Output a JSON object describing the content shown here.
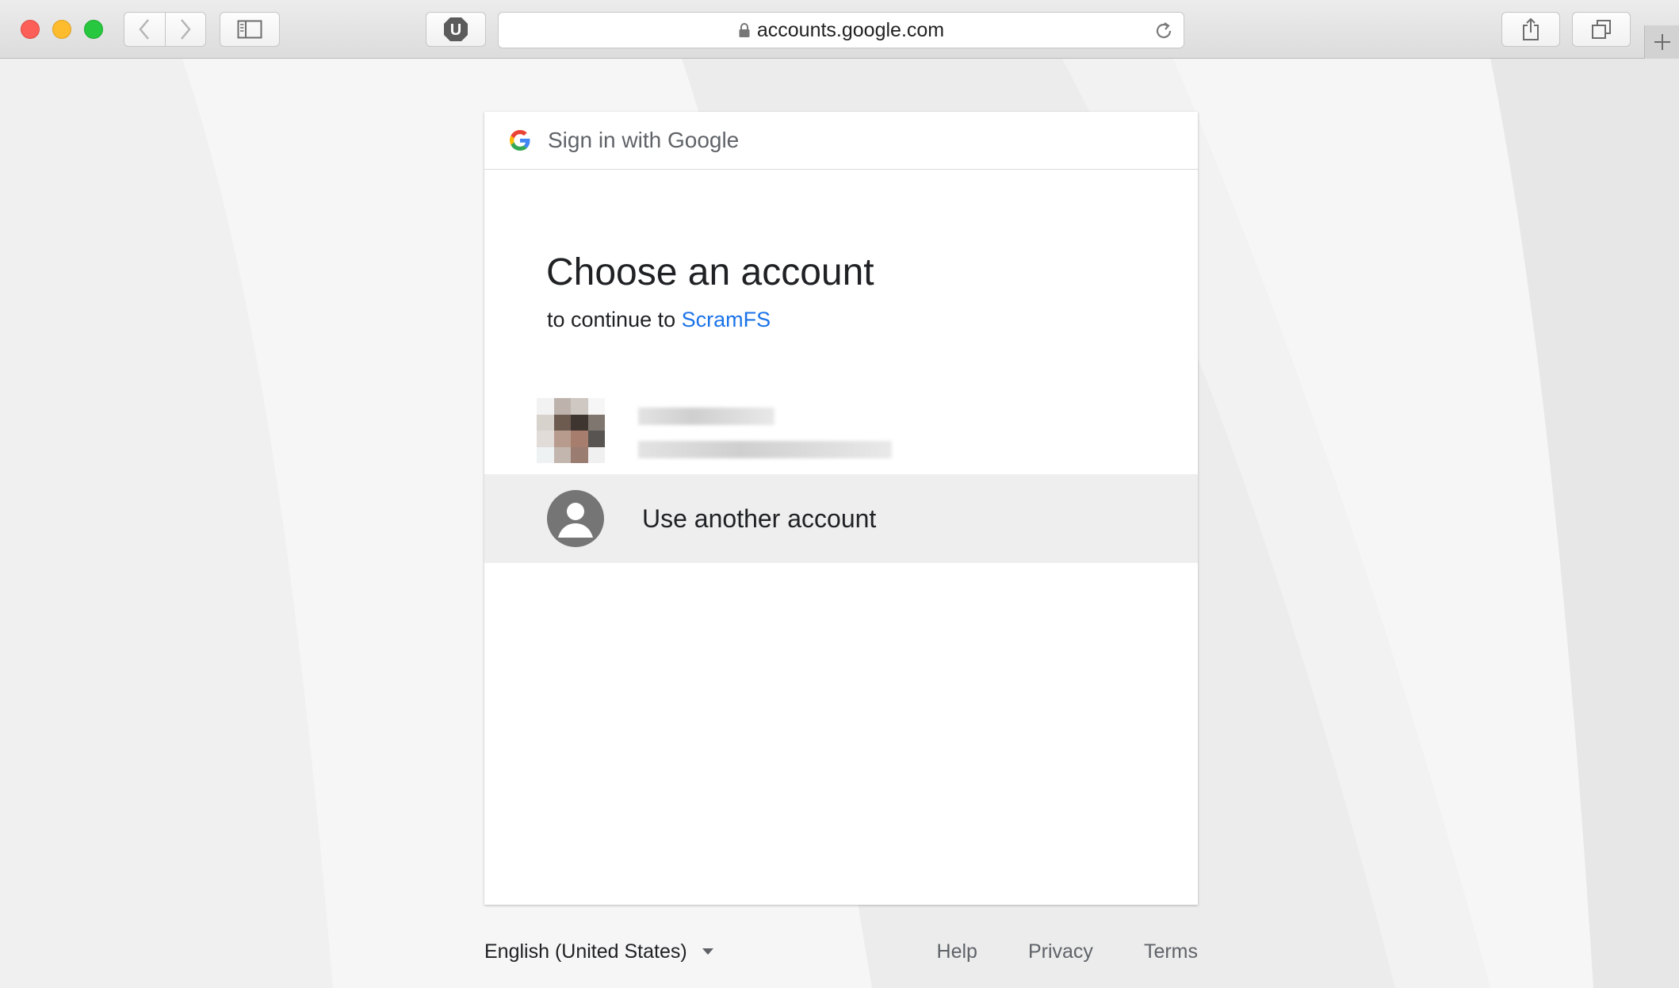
{
  "browser": {
    "url": "accounts.google.com",
    "extension_badge": "U",
    "icons": {
      "back": "chevron-left-icon",
      "forward": "chevron-right-icon",
      "sidebar": "sidebar-icon",
      "lock": "lock-icon",
      "reload": "reload-icon",
      "share": "share-icon",
      "tabs": "tabs-icon",
      "new_tab": "plus-icon"
    }
  },
  "card": {
    "header_title": "Sign in with Google",
    "heading": "Choose an account",
    "subheading_prefix": "to continue to",
    "app_name": "ScramFS",
    "other_account_label": "Use another account"
  },
  "footer": {
    "language": "English (United States)",
    "links": [
      "Help",
      "Privacy",
      "Terms"
    ]
  },
  "colors": {
    "accent_link": "#1a73e8",
    "row_hover": "#eeeeee"
  }
}
